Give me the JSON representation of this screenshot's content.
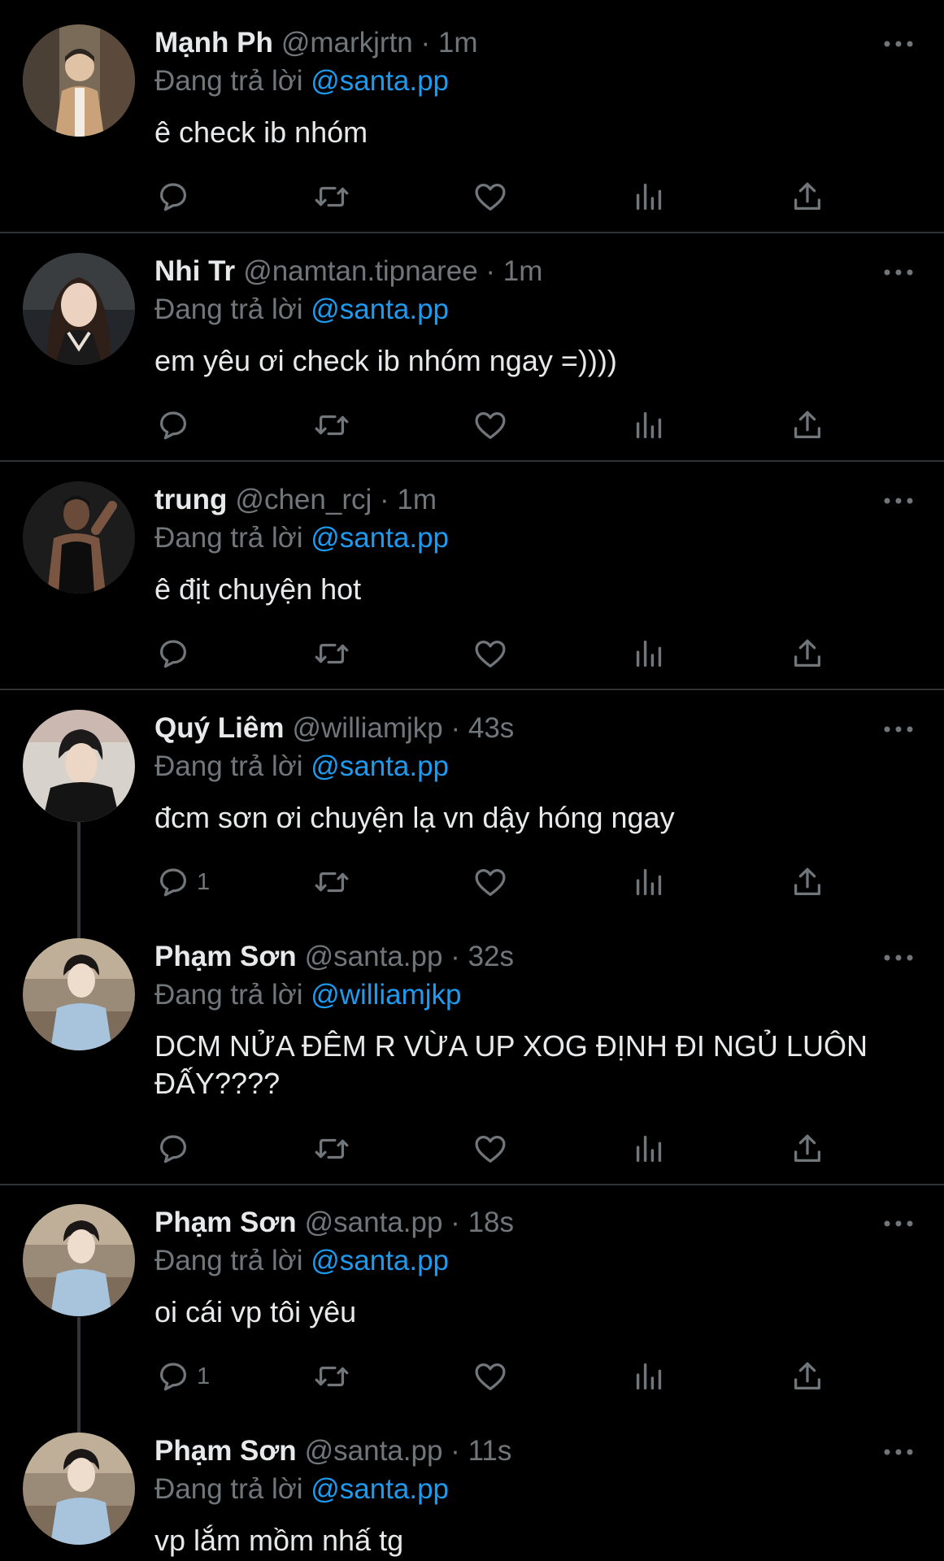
{
  "colors": {
    "background": "#000000",
    "text": "#e7e9ea",
    "muted": "#71767b",
    "mention": "#1d9bf0",
    "divider": "#2f3336"
  },
  "icons": {
    "reply": "reply-icon",
    "retweet": "retweet-icon",
    "like": "heart-icon",
    "views": "bar-chart-icon",
    "share": "share-icon",
    "more": "more-icon"
  },
  "tweets": [
    {
      "name": "Mạnh Ph",
      "meta": "@markjrtn · 1m",
      "reply_prefix": "Đang trả lời",
      "reply_to": "@santa.pp",
      "text": "ê check ib nhóm",
      "reply_count": ""
    },
    {
      "name": "Nhi Tr",
      "meta": "@namtan.tipnaree · 1m",
      "reply_prefix": "Đang trả lời",
      "reply_to": "@santa.pp",
      "text": "em yêu ơi check ib nhóm ngay =))))",
      "reply_count": ""
    },
    {
      "name": "trung",
      "meta": "@chen_rcj · 1m",
      "reply_prefix": "Đang trả lời",
      "reply_to": "@santa.pp",
      "text": "ê địt chuyện hot",
      "reply_count": ""
    },
    {
      "name": "Quý Liêm",
      "meta": "@williamjkp · 43s",
      "reply_prefix": "Đang trả lời",
      "reply_to": "@santa.pp",
      "text": "đcm sơn ơi chuyện lạ vn dậy hóng ngay",
      "reply_count": "1"
    },
    {
      "name": "Phạm Sơn",
      "meta": "@santa.pp · 32s",
      "reply_prefix": "Đang trả lời",
      "reply_to": "@williamjkp",
      "text": "DCM NỬA ĐÊM R VỪA UP XOG ĐỊNH ĐI NGỦ LUÔN ĐẤY????",
      "reply_count": ""
    },
    {
      "name": "Phạm Sơn",
      "meta": "@santa.pp · 18s",
      "reply_prefix": "Đang trả lời",
      "reply_to": "@santa.pp",
      "text": "oi cái vp tôi yêu",
      "reply_count": "1"
    },
    {
      "name": "Phạm Sơn",
      "meta": "@santa.pp · 11s",
      "reply_prefix": "Đang trả lời",
      "reply_to": "@santa.pp",
      "text": "vp lắm mồm nhấ tg",
      "reply_count": ""
    }
  ]
}
